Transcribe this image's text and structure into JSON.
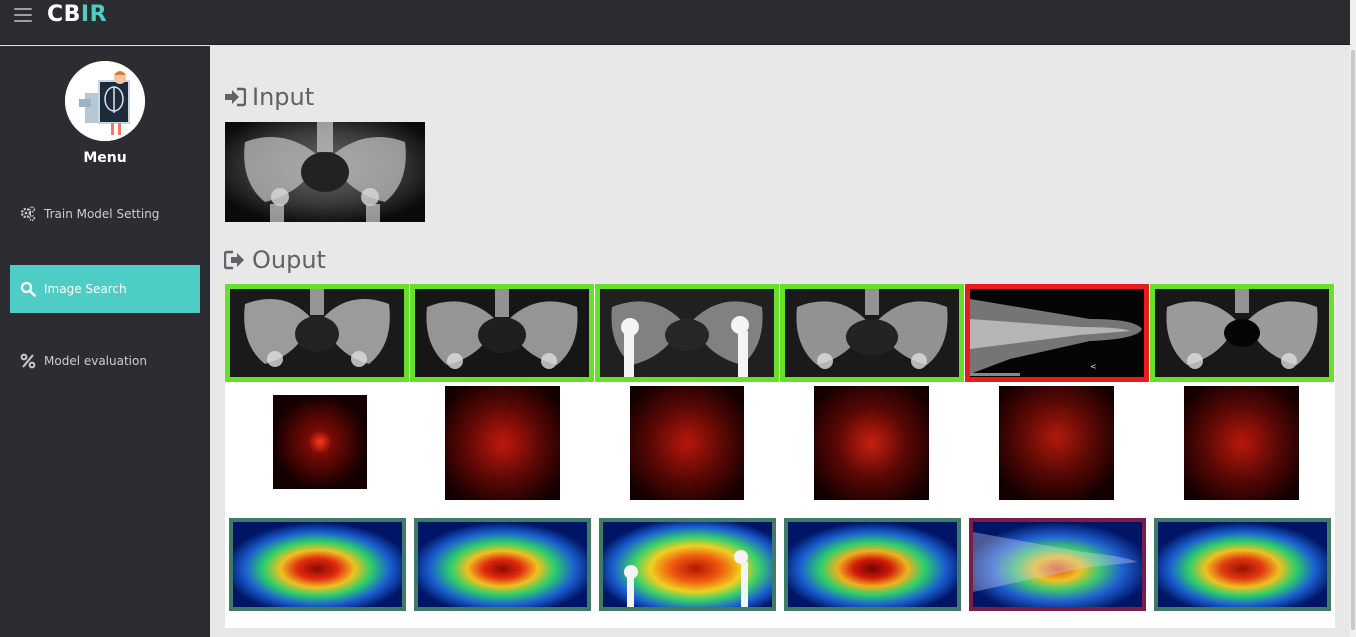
{
  "brand": {
    "part1": "CB",
    "part2": "IR"
  },
  "sidebar": {
    "menu_title": "Menu",
    "items": [
      {
        "label": "Train Model Setting",
        "icon": "gears-icon",
        "active": false
      },
      {
        "label": "Image Search",
        "icon": "search-icon",
        "active": true
      },
      {
        "label": "Model evaluation",
        "icon": "percent-icon",
        "active": false
      }
    ]
  },
  "main": {
    "input_title": "Input",
    "output_title": "Ouput",
    "results": [
      {
        "match": true
      },
      {
        "match": true
      },
      {
        "match": true
      },
      {
        "match": true
      },
      {
        "match": false
      },
      {
        "match": true
      }
    ]
  },
  "colors": {
    "accent": "#4ecdc4",
    "match_border": "#66e02b",
    "mismatch_border": "#e8191f"
  }
}
